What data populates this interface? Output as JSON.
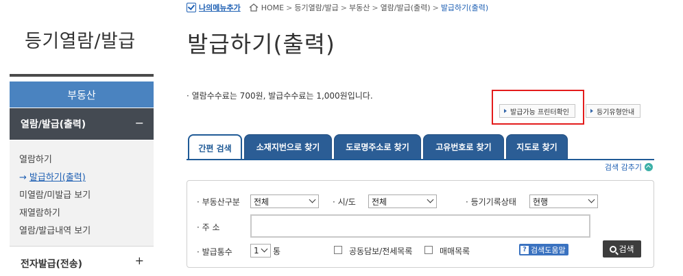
{
  "sidebar": {
    "title": "등기열람/발급",
    "section": "부동산",
    "active_group": {
      "label": "열람/발급(출력)",
      "toggle": "−"
    },
    "items": [
      {
        "label": "열람하기",
        "active": false
      },
      {
        "label": "발급하기(출력)",
        "active": true
      },
      {
        "label": "미열람/미발급 보기",
        "active": false
      },
      {
        "label": "재열람하기",
        "active": false
      },
      {
        "label": "열람/발급내역 보기",
        "active": false
      }
    ],
    "next_group": {
      "label": "전자발급(전송)",
      "toggle": "+"
    },
    "active_arrow": "→"
  },
  "breadcrumb": {
    "my_menu_label": "나의메뉴추가",
    "home": "HOME",
    "items": [
      "등기열람/발급",
      "부동산",
      "열람/발급(출력)",
      "발급하기(출력)"
    ],
    "sep": ">"
  },
  "page_title": "발급하기(출력)",
  "notice": "· 열람수수료는 700원, 발급수수료는 1,000원입니다.",
  "buttons": {
    "printer_check": "발급가능 프린터확인",
    "registry_type": "등기유형안내"
  },
  "tabs": [
    {
      "label": "간편 검색",
      "selected": true
    },
    {
      "label": "소재지번으로 찾기",
      "selected": false
    },
    {
      "label": "도로명주소로 찾기",
      "selected": false
    },
    {
      "label": "고유번호로 찾기",
      "selected": false
    },
    {
      "label": "지도로 찾기",
      "selected": false
    }
  ],
  "collapse_search": "검색 감추기",
  "form": {
    "property_type": {
      "label": "· 부동산구분",
      "value": "전체"
    },
    "region": {
      "label": "· 시/도",
      "value": "전체"
    },
    "record_status": {
      "label": "· 등기기록상태",
      "value": "현행"
    },
    "address": {
      "label": "· 주 소",
      "value": ""
    },
    "copies": {
      "label": "· 발급통수",
      "value": "1",
      "unit": "통"
    },
    "joint_collateral": {
      "label": "공동담보/전세목록",
      "checked": false
    },
    "sale_list": {
      "label": "매매목록",
      "checked": false
    },
    "help_label": "검색도움말",
    "help_icon": "?",
    "search_label": "검색"
  },
  "colors": {
    "accent_blue": "#1d5fb3",
    "tab_blue": "#2b5d95",
    "sidebar_head": "#4a83c0",
    "sidebar_active": "#444a52",
    "highlight_red": "#e31b1b"
  }
}
